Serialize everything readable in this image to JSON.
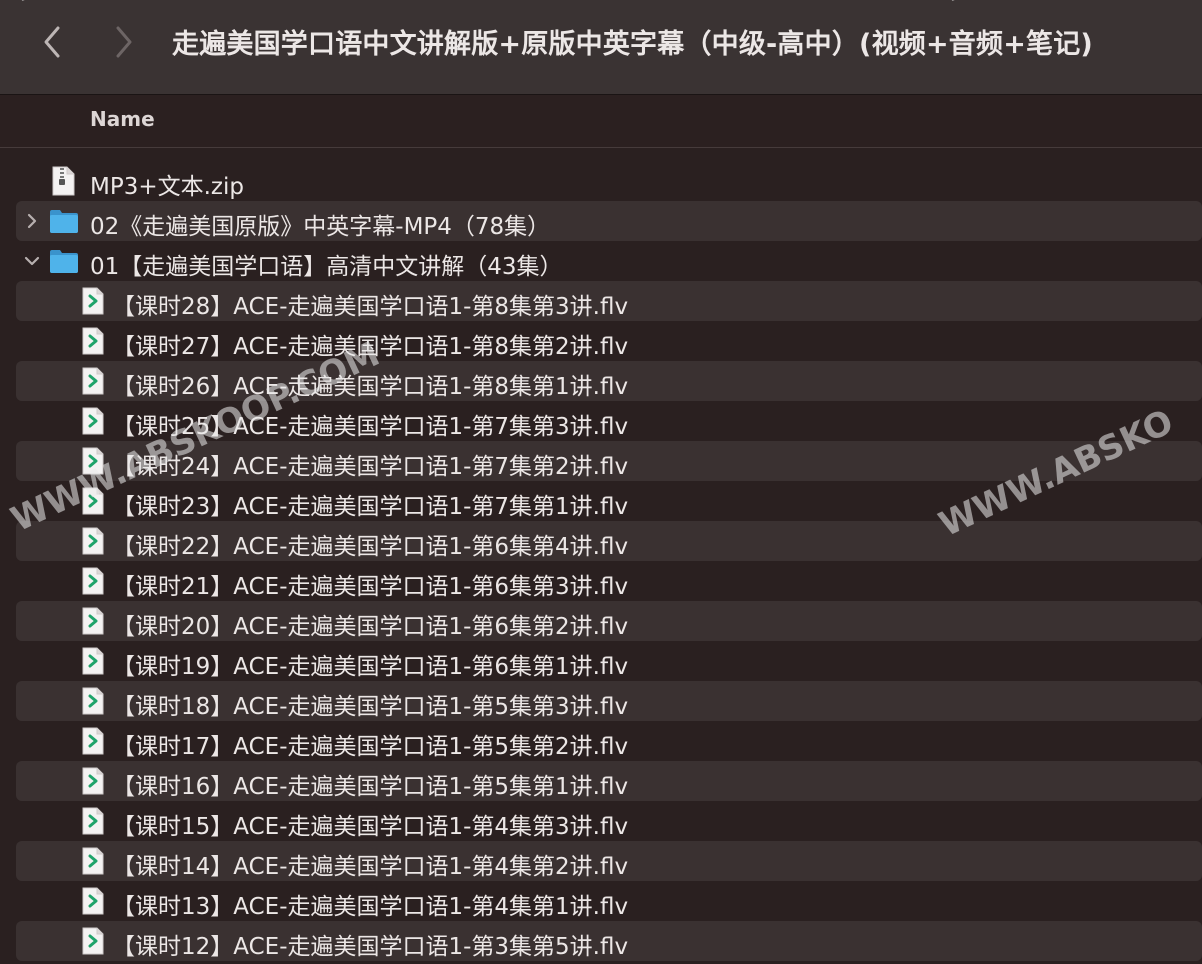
{
  "window": {
    "title": "走遍美国学口语中文讲解版+原版中英字幕（中级-高中）(视频+音频+笔记)",
    "back_icon": "chevron-left-icon",
    "forward_icon": "chevron-right-icon"
  },
  "header": {
    "name_column": "Name"
  },
  "items": [
    {
      "label": "MP3+文本.zip",
      "type": "zip",
      "level": 0,
      "expanded": null
    },
    {
      "label": "02《走遍美国原版》中英字幕-MP4（78集）",
      "type": "folder",
      "level": 0,
      "expanded": false
    },
    {
      "label": "01【走遍美国学口语】高清中文讲解（43集）",
      "type": "folder",
      "level": 0,
      "expanded": true
    },
    {
      "label": "【课时28】ACE-走遍美国学口语1-第8集第3讲.flv",
      "type": "video",
      "level": 1
    },
    {
      "label": "【课时27】ACE-走遍美国学口语1-第8集第2讲.flv",
      "type": "video",
      "level": 1
    },
    {
      "label": "【课时26】ACE-走遍美国学口语1-第8集第1讲.flv",
      "type": "video",
      "level": 1
    },
    {
      "label": "【课时25】ACE-走遍美国学口语1-第7集第3讲.flv",
      "type": "video",
      "level": 1
    },
    {
      "label": "【课时24】ACE-走遍美国学口语1-第7集第2讲.flv",
      "type": "video",
      "level": 1
    },
    {
      "label": "【课时23】ACE-走遍美国学口语1-第7集第1讲.flv",
      "type": "video",
      "level": 1
    },
    {
      "label": "【课时22】ACE-走遍美国学口语1-第6集第4讲.flv",
      "type": "video",
      "level": 1
    },
    {
      "label": "【课时21】ACE-走遍美国学口语1-第6集第3讲.flv",
      "type": "video",
      "level": 1
    },
    {
      "label": "【课时20】ACE-走遍美国学口语1-第6集第2讲.flv",
      "type": "video",
      "level": 1
    },
    {
      "label": "【课时19】ACE-走遍美国学口语1-第6集第1讲.flv",
      "type": "video",
      "level": 1
    },
    {
      "label": "【课时18】ACE-走遍美国学口语1-第5集第3讲.flv",
      "type": "video",
      "level": 1
    },
    {
      "label": "【课时17】ACE-走遍美国学口语1-第5集第2讲.flv",
      "type": "video",
      "level": 1
    },
    {
      "label": "【课时16】ACE-走遍美国学口语1-第5集第1讲.flv",
      "type": "video",
      "level": 1
    },
    {
      "label": "【课时15】ACE-走遍美国学口语1-第4集第3讲.flv",
      "type": "video",
      "level": 1
    },
    {
      "label": "【课时14】ACE-走遍美国学口语1-第4集第2讲.flv",
      "type": "video",
      "level": 1
    },
    {
      "label": "【课时13】ACE-走遍美国学口语1-第4集第1讲.flv",
      "type": "video",
      "level": 1
    },
    {
      "label": "【课时12】ACE-走遍美国学口语1-第3集第5讲.flv",
      "type": "video",
      "level": 1
    }
  ],
  "watermarks": [
    "WWW.ABSKOOP.COM",
    "WWW.ABSKO"
  ],
  "colors": {
    "folder": "#4fb3ea",
    "video_accent": "#1fa36a",
    "alt_row": "#3a3131"
  }
}
